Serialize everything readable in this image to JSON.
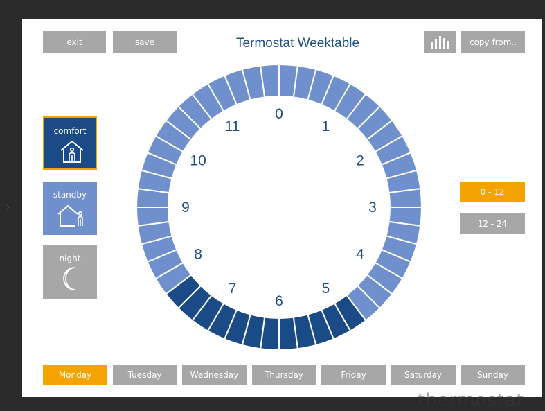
{
  "header": {
    "title": "Termostat Weektable",
    "exit_label": "exit",
    "save_label": "save",
    "copy_label": "copy from.."
  },
  "modes": {
    "comfort_label": "comfort",
    "standby_label": "standby",
    "night_label": "night"
  },
  "range": {
    "first_label": "0 - 12",
    "second_label": "12 - 24",
    "selected": "0 - 12"
  },
  "days": [
    "Monday",
    "Tuesday",
    "Wednesday",
    "Thursday",
    "Friday",
    "Saturday",
    "Sunday"
  ],
  "selected_day": "Monday",
  "clock": {
    "hour_labels": [
      "0",
      "1",
      "2",
      "3",
      "4",
      "5",
      "6",
      "7",
      "8",
      "9",
      "10",
      "11"
    ],
    "slots": [
      "standby",
      "standby",
      "standby",
      "standby",
      "standby",
      "standby",
      "standby",
      "standby",
      "standby",
      "standby",
      "standby",
      "standby",
      "standby",
      "standby",
      "standby",
      "standby",
      "standby",
      "standby",
      "standby",
      "comfort",
      "comfort",
      "comfort",
      "comfort",
      "comfort",
      "comfort",
      "comfort",
      "comfort",
      "comfort",
      "comfort",
      "comfort",
      "comfort",
      "standby",
      "standby",
      "standby",
      "standby",
      "standby",
      "standby",
      "standby",
      "standby",
      "standby",
      "standby",
      "standby",
      "standby",
      "standby",
      "standby",
      "standby",
      "standby",
      "standby"
    ]
  },
  "colors": {
    "comfort": "#1b4b86",
    "standby": "#6f8fcd",
    "night": "#a7a7a7",
    "accent": "#f4a300",
    "text": "#1f4f86"
  },
  "watermark": "thermostat"
}
